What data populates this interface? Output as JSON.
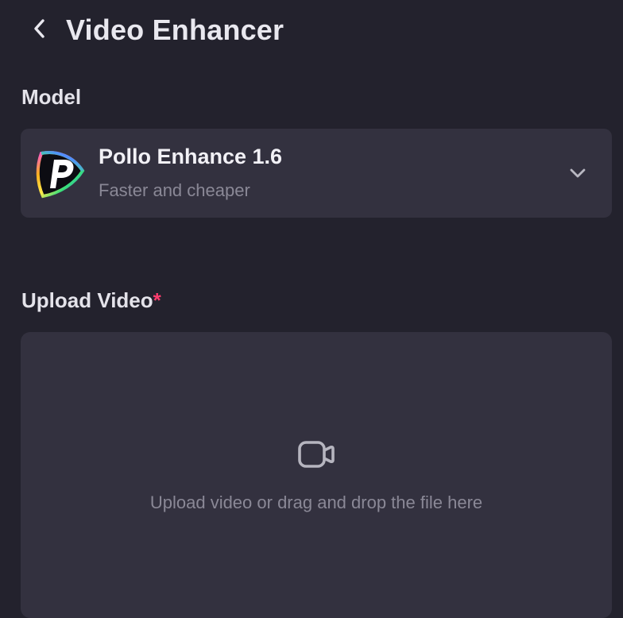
{
  "header": {
    "back_icon": "chevron-left-icon",
    "title": "Video Enhancer"
  },
  "model_section": {
    "label": "Model",
    "selected_model": {
      "logo_icon": "pollo-logo-icon",
      "name": "Pollo Enhance 1.6",
      "description": "Faster and cheaper",
      "dropdown_icon": "chevron-down-icon"
    }
  },
  "upload_section": {
    "label": "Upload Video",
    "required_marker": "*",
    "dropzone": {
      "icon": "video-camera-icon",
      "hint": "Upload video or drag and drop the file here"
    }
  },
  "colors": {
    "background": "#23222d",
    "card": "#33313f",
    "required": "#ff3d6e",
    "muted_text": "#8a8896"
  }
}
